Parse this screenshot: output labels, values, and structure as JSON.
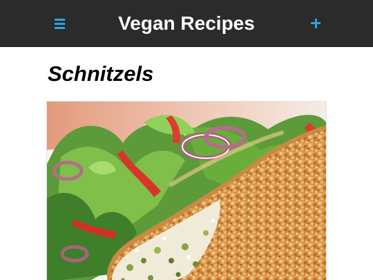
{
  "header": {
    "title": "Vegan Recipes",
    "menu_icon": "hamburger-menu-icon",
    "add_icon": "plus-icon"
  },
  "recipe": {
    "title": "Schnitzels",
    "image_subject": "breaded schnitzel with green salad"
  },
  "colors": {
    "header_bg": "#2b2b2b",
    "accent": "#2aa3e0",
    "header_text": "#ffffff"
  }
}
